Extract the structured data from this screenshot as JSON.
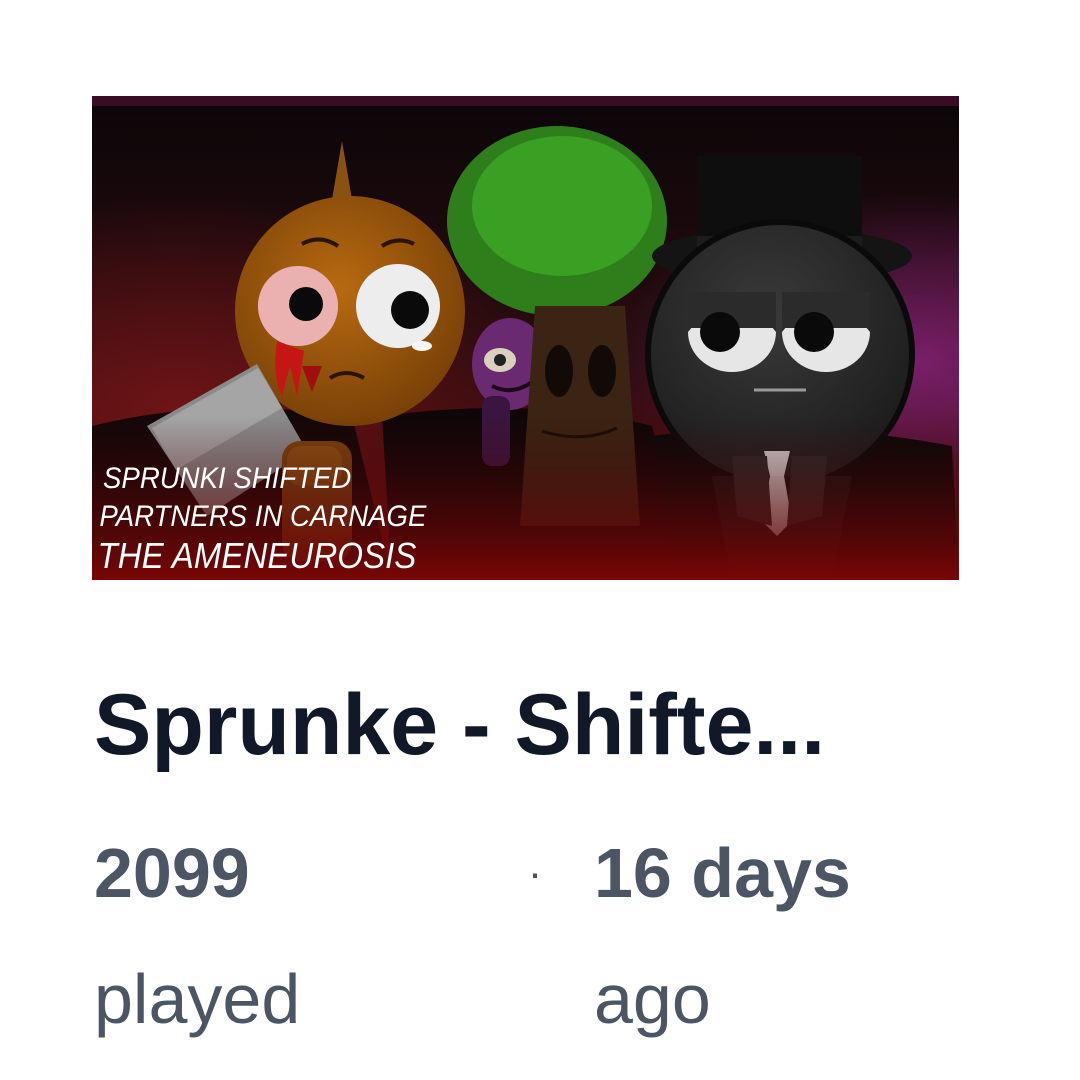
{
  "thumbnail": {
    "caption_lines": [
      "SPRUNKI SHIFTED",
      "PARTNERS IN CARNAGE",
      "THE AMENEUROSIS"
    ]
  },
  "game": {
    "title": "Sprunke - Shifte...",
    "plays_count": "2099",
    "plays_unit": "played",
    "separator": "·",
    "age_value": "16 days",
    "age_unit": "ago"
  },
  "colors": {
    "title": "#111827",
    "meta": "#4b5563",
    "background": "#ffffff"
  }
}
